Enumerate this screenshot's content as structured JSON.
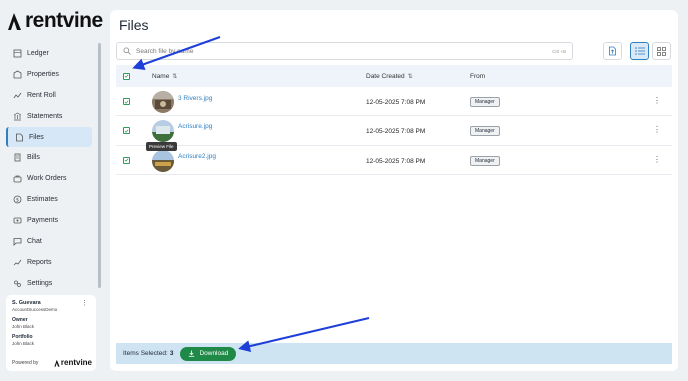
{
  "brand": {
    "name": "rentvine"
  },
  "sidebar": {
    "items": [
      {
        "label": "Ledger",
        "icon": "ledger-icon",
        "active": false
      },
      {
        "label": "Properties",
        "icon": "properties-icon",
        "active": false
      },
      {
        "label": "Rent Roll",
        "icon": "rent-roll-icon",
        "active": false
      },
      {
        "label": "Statements",
        "icon": "statements-icon",
        "active": false
      },
      {
        "label": "Files",
        "icon": "files-icon",
        "active": true
      },
      {
        "label": "Bills",
        "icon": "bills-icon",
        "active": false
      },
      {
        "label": "Work Orders",
        "icon": "work-orders-icon",
        "active": false
      },
      {
        "label": "Estimates",
        "icon": "estimates-icon",
        "active": false
      },
      {
        "label": "Payments",
        "icon": "payments-icon",
        "active": false
      },
      {
        "label": "Chat",
        "icon": "chat-icon",
        "active": false
      },
      {
        "label": "Reports",
        "icon": "reports-icon",
        "active": false
      },
      {
        "label": "Settings",
        "icon": "settings-icon",
        "active": false
      }
    ]
  },
  "profile": {
    "name": "S. Guevara",
    "account": "AccountSuccessDemo",
    "owner_label": "Owner",
    "owner": "John Black",
    "portfolio_label": "Portfolio",
    "portfolio": "John Black",
    "powered_by": "Powered by",
    "powered_brand": "rentvine"
  },
  "main": {
    "title": "Files",
    "search": {
      "placeholder": "Search file by name",
      "shortcut": "Ctrl +B"
    }
  },
  "table": {
    "headers": {
      "name": "Name",
      "date": "Date Created",
      "from": "From"
    },
    "rows": [
      {
        "name": "3 Rivers.jpg",
        "date": "12-05-2025 7:08 PM",
        "from": "Manager",
        "checked": true
      },
      {
        "name": "Acrisure.jpg",
        "date": "12-05-2025 7:08 PM",
        "from": "Manager",
        "checked": true
      },
      {
        "name": "Acrisure2.jpg",
        "date": "12-05-2025 7:08 PM",
        "from": "Manager",
        "checked": true
      }
    ],
    "tooltip": "Preview File"
  },
  "footer": {
    "selected_label": "Items Selected:",
    "selected_count": "3",
    "download_label": "Download"
  },
  "colors": {
    "accent": "#2f7fc1",
    "success": "#1f8a48",
    "annotation_arrow": "#1f3fd9"
  }
}
